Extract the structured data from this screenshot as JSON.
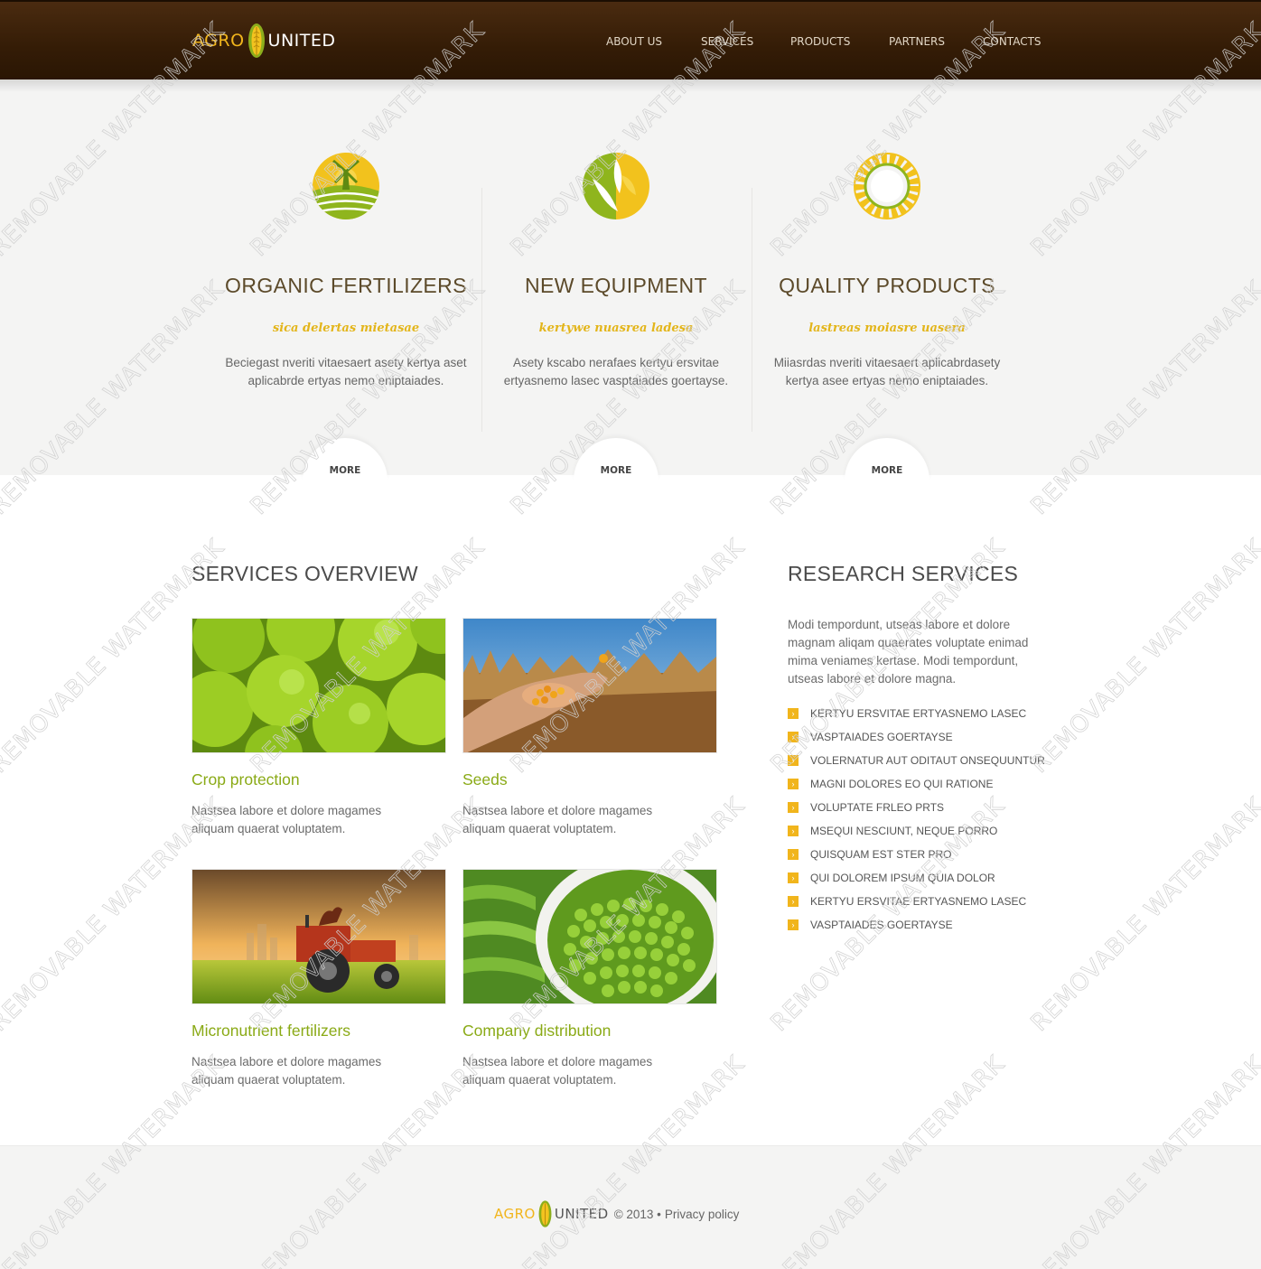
{
  "header": {
    "logo": {
      "agro": "AGRO",
      "united": "UNITED"
    },
    "nav": [
      "ABOUT US",
      "SERVICES",
      "PRODUCTS",
      "PARTNERS",
      "CONTACTS"
    ]
  },
  "features": [
    {
      "icon": "windmill-field-icon",
      "title": "ORGANIC FERTILIZERS",
      "subtitle": "sica delertas mietasae",
      "text": "Beciegast nveriti vitaesaert asety kertya aset aplicabrde ertyas nemo eniptaiades.",
      "more": "MORE"
    },
    {
      "icon": "leaf-wheat-icon",
      "title": "NEW EQUIPMENT",
      "subtitle": "kertywe nuasrea ladesa",
      "text": "Asety kscabo nerafaes kertyu ersvitae ertyasnemo lasec vasptaiades goertayse.",
      "more": "MORE"
    },
    {
      "icon": "wheat-wreath-icon",
      "title": "QUALITY PRODUCTS",
      "subtitle": "lastreas moiasre uasera",
      "text": "Miiasrdas nveriti vitaesaert aplicabrdasety kertya asee ertyas nemo eniptaiades.",
      "more": "MORE"
    }
  ],
  "services": {
    "title": "SERVICES OVERVIEW",
    "cards": [
      {
        "image": "green-apples-photo",
        "title": "Crop protection",
        "text": "Nastsea labore et dolore magames aliquam quaerat voluptatem."
      },
      {
        "image": "hand-corn-seeds-photo",
        "title": "Seeds",
        "text": "Nastsea labore et dolore magames aliquam quaerat voluptatem."
      },
      {
        "image": "tractor-rooster-photo",
        "title": "Micronutrient fertilizers",
        "text": "Nastsea labore et dolore magames aliquam quaerat voluptatem."
      },
      {
        "image": "green-peas-bowl-photo",
        "title": "Company distribution",
        "text": "Nastsea labore et dolore magames aliquam quaerat voluptatem."
      }
    ]
  },
  "research": {
    "title": "RESEARCH SERVICES",
    "text": "Modi tempordunt, utseas labore et dolore magnam aliqam quaerates voluptate enimad mima veniames kertase. Modi tempordunt, utseas labore et dolore magna.",
    "items": [
      "KERTYU ERSVITAE ERTYASNEMO LASEC",
      "VASPTAIADES GOERTAYSE",
      "VOLERNATUR AUT ODITAUT ONSEQUUNTUR",
      "MAGNI DOLORES EO QUI RATIONE",
      "VOLUPTATE FRLEO PRTS",
      "MSEQUI NESCIUNT, NEQUE PORRO",
      "QUISQUAM EST STER PRO",
      "QUI DOLOREM IPSUM QUIA DOLOR",
      "KERTYU ERSVITAE ERTYASNEMO LASEC",
      "VASPTAIADES GOERTAYSE"
    ],
    "bullet": "›"
  },
  "footer": {
    "logo": {
      "agro": "AGRO",
      "united": "UNITED"
    },
    "copyright": "© 2013 •",
    "privacy": "Privacy policy"
  },
  "watermark": "REMOVABLE WATERMARK",
  "colors": {
    "brand_yellow": "#f1b51c",
    "header_brown": "#341c06",
    "title_brown": "#5c4a2a",
    "card_green": "#8aaa16",
    "background": "#f4f4f3"
  }
}
